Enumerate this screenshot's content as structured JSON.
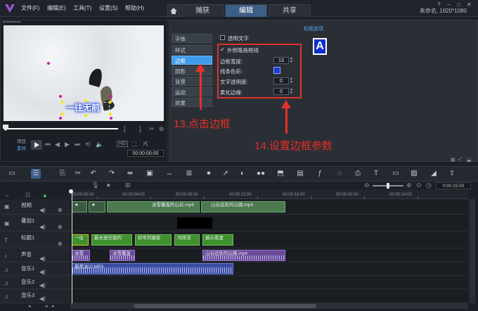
{
  "menu": [
    "文件(F)",
    "编辑(E)",
    "工具(T)",
    "设置(S)",
    "帮助(H)"
  ],
  "tabs": [
    "捕获",
    "编辑",
    "共享"
  ],
  "active_tab": "编辑",
  "project_info": "未命名, 1920*1080",
  "preview": {
    "subtitle_text": "一往无前",
    "mode_labels": [
      "项目",
      "素材"
    ],
    "timecode": "00:00:00:00"
  },
  "options": {
    "side_tabs": [
      "字体",
      "样式",
      "边框",
      "阴影",
      "背景",
      "运动",
      "效果"
    ],
    "active_side_tab": "边框",
    "transparent_text_label": "透明文字",
    "outer_stroke_label": "外侧笔画框线",
    "border_width_label": "边框宽度:",
    "border_width_value": "13",
    "line_color_label": "线条色彩:",
    "line_color": "#1f3ad8",
    "text_transparency_label": "文字透明度:",
    "text_transparency_value": "0",
    "soft_edge_label": "柔化边缘:",
    "soft_edge_value": "0",
    "title_options_label": "标题选项",
    "preview_letter": "A"
  },
  "annotations": {
    "step13": "13.点击边框",
    "step14": "14.设置边框参数"
  },
  "timeline": {
    "zoom_time": "0:00:15:00",
    "ruler": [
      "00:00:00:00",
      "00:00:04:00",
      "00:00:08:00",
      "00:00:12:00",
      "00:00:16:00",
      "00:00:20:00",
      "00:00:24:00"
    ],
    "tracks": [
      {
        "label": "视频"
      },
      {
        "label": "叠加1"
      },
      {
        "label": "标题1"
      },
      {
        "label": "声音"
      },
      {
        "label": "音乐1"
      },
      {
        "label": "音乐2"
      },
      {
        "label": "音乐3"
      }
    ],
    "clips": {
      "video": [
        "冰雪覆盖的山谷.mp4",
        "山谷远处的公路.mp4"
      ],
      "title": [
        "一往",
        "最长纸任我的",
        "初冬的嬉耍",
        "河床流",
        "展示看里"
      ],
      "voice": [
        "冰雪",
        "冰雪覆盖",
        "山谷远处的公路.mp4"
      ],
      "music": "最美冰川.MP3"
    }
  }
}
